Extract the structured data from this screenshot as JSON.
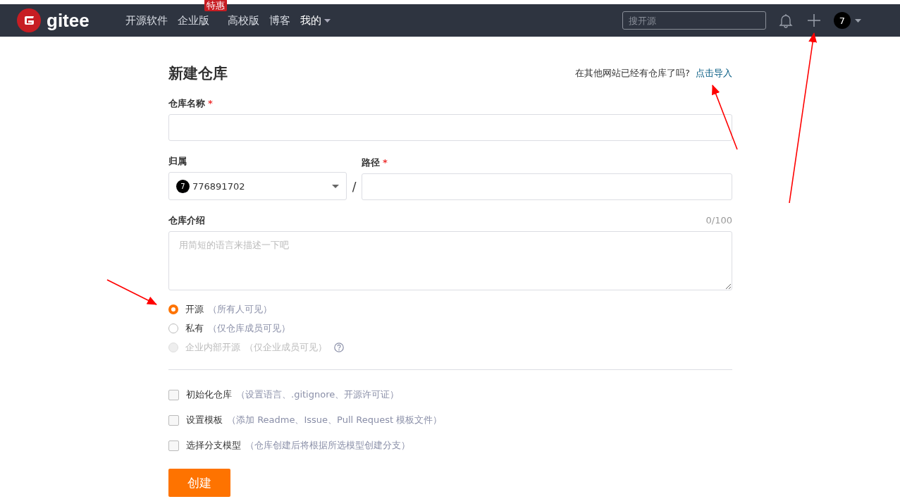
{
  "navbar": {
    "logo_text": "gitee",
    "items": [
      {
        "label": "开源软件",
        "dropdown": false,
        "current": false
      },
      {
        "label": "企业版",
        "badge": "特惠",
        "dropdown": false,
        "current": false
      },
      {
        "label": "高校版",
        "dropdown": false,
        "current": false
      },
      {
        "label": "博客",
        "dropdown": false,
        "current": false
      },
      {
        "label": "我的",
        "dropdown": true,
        "current": true
      }
    ],
    "search": {
      "placeholder": "搜开源"
    },
    "avatar_text": "7"
  },
  "form": {
    "title": "新建仓库",
    "import_prompt": "在其他网站已经有仓库了吗?",
    "import_link": "点击导入",
    "name_field": {
      "label": "仓库名称",
      "required_mark": "*"
    },
    "owner_field": {
      "label": "归属",
      "avatar_text": "7",
      "value": "776891702"
    },
    "separator": "/",
    "path_field": {
      "label": "路径",
      "required_mark": "*"
    },
    "description": {
      "label": "仓库介绍",
      "counter": "0/100",
      "placeholder": "用简短的语言来描述一下吧"
    },
    "visibility": [
      {
        "label": "开源",
        "hint": "（所有人可见）",
        "selected": true,
        "disabled": false,
        "help": false
      },
      {
        "label": "私有",
        "hint": "（仅仓库成员可见）",
        "selected": false,
        "disabled": false,
        "help": false
      },
      {
        "label": "企业内部开源",
        "hint": "（仅企业成员可见）",
        "selected": false,
        "disabled": true,
        "help": true
      }
    ],
    "options": [
      {
        "label": "初始化仓库",
        "hint": "（设置语言、.gitignore、开源许可证）",
        "checked": false
      },
      {
        "label": "设置模板",
        "hint": "（添加 Readme、Issue、Pull Request 模板文件）",
        "checked": false
      },
      {
        "label": "选择分支模型",
        "hint": "（仓库创建后将根据所选模型创建分支）",
        "checked": false
      }
    ],
    "submit": "创建"
  }
}
